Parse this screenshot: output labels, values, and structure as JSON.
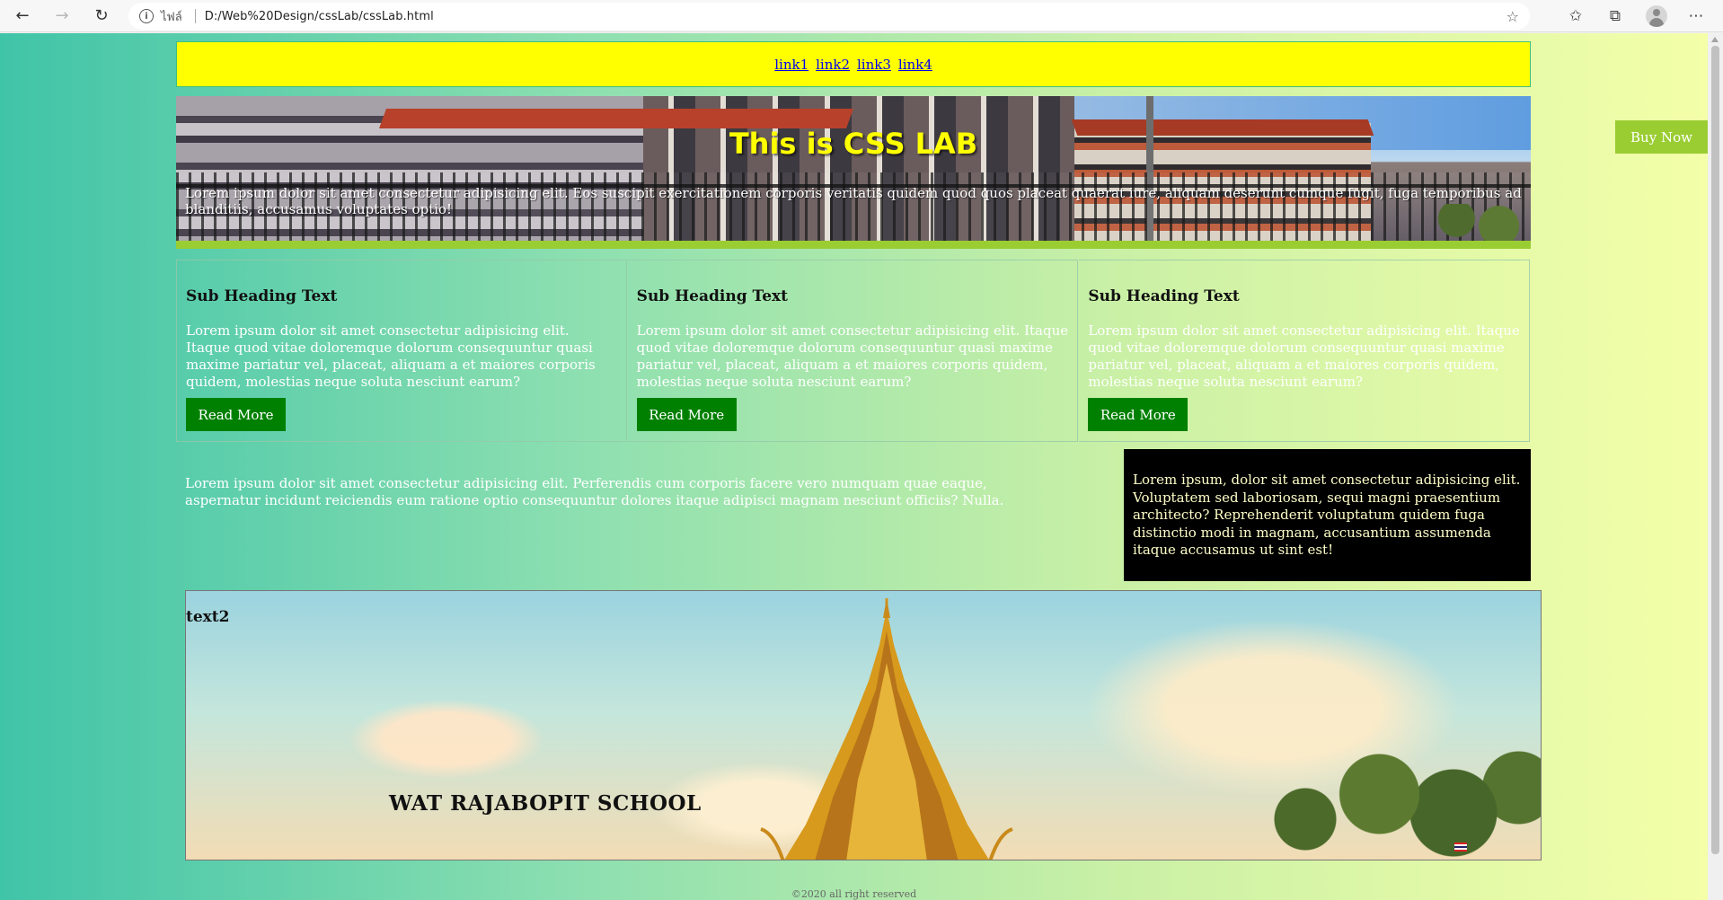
{
  "browser": {
    "back_glyph": "←",
    "forward_glyph": "→",
    "reload_glyph": "↻",
    "info_glyph": "i",
    "scheme_label": "ไฟล์",
    "url": "D:/Web%20Design/cssLab/cssLab.html",
    "favorite_glyph": "☆",
    "favorites_glyph": "✩",
    "collections_glyph": "⧉",
    "more_glyph": "⋯"
  },
  "page": {
    "nav": {
      "links": [
        "link1",
        "link2",
        "link3",
        "link4"
      ]
    },
    "hero": {
      "title": "This is CSS LAB",
      "text": "Lorem ipsum dolor sit amet consectetur adipisicing elit. Eos suscipit exercitationem corporis veritatis quidem quod quos placeat quaerat iure, aliquam deserunt cumque fugit, fuga temporibus ad blanditiis, accusamus voluptates optio!"
    },
    "buy_button": "Buy Now",
    "cards": [
      {
        "heading": "Sub Heading Text",
        "text": "Lorem ipsum dolor sit amet consectetur adipisicing elit. Itaque quod vitae doloremque dolorum consequuntur quasi maxime pariatur vel, placeat, aliquam a et maiores corporis quidem, molestias neque soluta nesciunt earum?",
        "button": "Read More"
      },
      {
        "heading": "Sub Heading Text",
        "text": "Lorem ipsum dolor sit amet consectetur adipisicing elit. Itaque quod vitae doloremque dolorum consequuntur quasi maxime pariatur vel, placeat, aliquam a et maiores corporis quidem, molestias neque soluta nesciunt earum?",
        "button": "Read More"
      },
      {
        "heading": "Sub Heading Text",
        "text": "Lorem ipsum dolor sit amet consectetur adipisicing elit. Itaque quod vitae doloremque dolorum consequuntur quasi maxime pariatur vel, placeat, aliquam a et maiores corporis quidem, molestias neque soluta nesciunt earum?",
        "button": "Read More"
      }
    ],
    "article_text": "Lorem ipsum dolor sit amet consectetur adipisicing elit. Perferendis cum corporis facere vero numquam quae eaque, aspernatur incidunt reiciendis eum ratione optio consequuntur dolores itaque adipisci magnam nesciunt officiis? Nulla.",
    "aside_text": "Lorem ipsum, dolor sit amet consectetur adipisicing elit. Voluptatem sed laboriosam, sequi magni praesentium architecto? Reprehenderit voluptatum quidem fuga distinctio modi in magnam, accusantium assumenda itaque accusamus ut sint est!",
    "banner": {
      "label": "text2",
      "school_name": "WAT RAJABOPIT SCHOOL"
    },
    "footer": "©2020 all right reserved"
  },
  "colors": {
    "nav_background": "#ffff00",
    "hero_title": "#ffff00",
    "accent_green": "#9acd32",
    "button_green": "#008000",
    "aside_background": "#000000"
  }
}
